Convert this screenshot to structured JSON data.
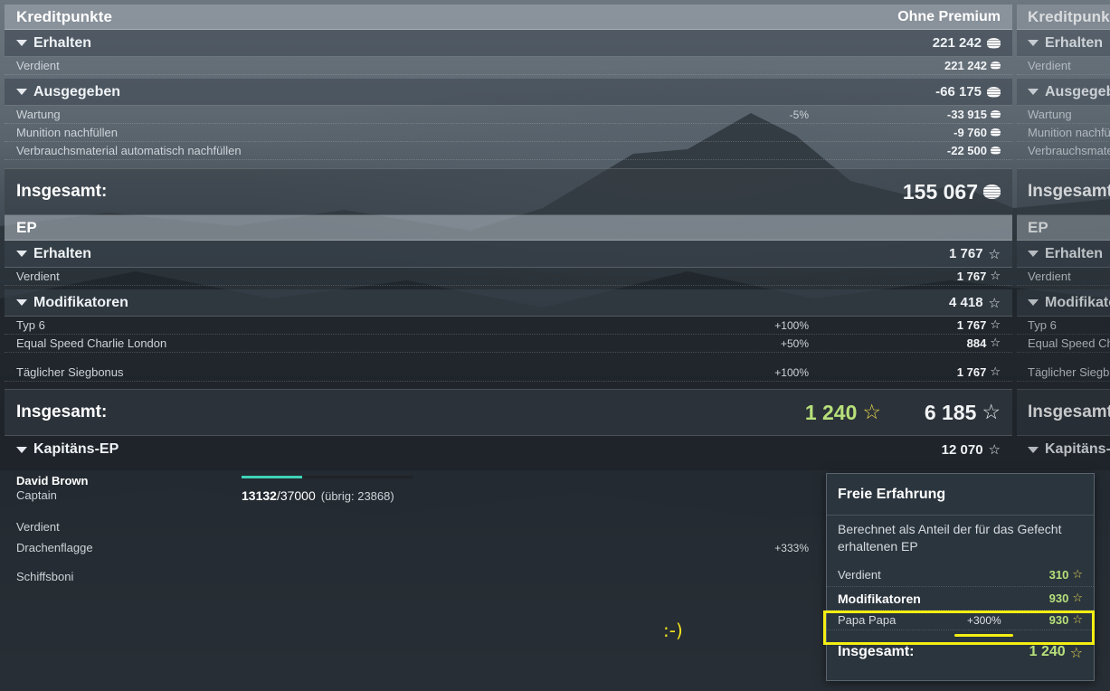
{
  "credits": {
    "title": "Kreditpunkte",
    "column_label": "Ohne Premium",
    "received": {
      "label": "Erhalten",
      "value": "221 242",
      "items": [
        {
          "label": "Verdient",
          "value": "221 242"
        }
      ]
    },
    "spent": {
      "label": "Ausgegeben",
      "value": "-66 175",
      "items": [
        {
          "label": "Wartung",
          "pct": "-5%",
          "value": "-33 915"
        },
        {
          "label": "Munition nachfüllen",
          "pct": "",
          "value": "-9 760"
        },
        {
          "label": "Verbrauchsmaterial automatisch nachfüllen",
          "pct": "",
          "value": "-22 500"
        }
      ]
    },
    "total": {
      "label": "Insgesamt:",
      "value": "155 067"
    }
  },
  "ep": {
    "title": "EP",
    "received": {
      "label": "Erhalten",
      "value": "1 767",
      "items": [
        {
          "label": "Verdient",
          "value": "1 767"
        }
      ]
    },
    "modifiers": {
      "label": "Modifikatoren",
      "value": "4 418",
      "items": [
        {
          "label": "Typ 6",
          "pct": "+100%",
          "value": "1 767"
        },
        {
          "label": "Equal Speed Charlie London",
          "pct": "+50%",
          "value": "884"
        },
        {
          "label": "Täglicher Siegbonus",
          "pct": "+100%",
          "value": "1 767"
        }
      ]
    },
    "total": {
      "label": "Insgesamt:",
      "free_value": "1 240",
      "value": "6 185"
    }
  },
  "captain_ep": {
    "label": "Kapitäns-EP",
    "value": "12 070",
    "captain_name": "David Brown",
    "captain_rank": "Captain",
    "xp_current": "13132",
    "xp_max": "/37000",
    "xp_remaining": "(übrig: 23868)",
    "progress": 0.355,
    "items": [
      {
        "label": "Verdient",
        "pct": ""
      },
      {
        "label": "Drachenflagge",
        "pct": "+333%"
      },
      {
        "label": "Schiffsboni",
        "pct": ""
      }
    ]
  },
  "annotation": ":-)",
  "tooltip": {
    "title": "Freie Erfahrung",
    "description": "Berechnet als Anteil der für das Gefecht erhaltenen EP",
    "earned_label": "Verdient",
    "earned_value": "310",
    "modifiers_label": "Modifikatoren",
    "modifiers_value": "930",
    "item_label": "Papa Papa",
    "item_pct": "+300%",
    "item_value": "930",
    "total_label": "Insgesamt:",
    "total_value": "1 240"
  },
  "second_panel": {
    "credits_title": "Kreditpunkte",
    "received_label": "Erhalten",
    "earned_label": "Verdient",
    "spent_label": "Ausgegeben",
    "spent_items": [
      "Wartung",
      "Munition nachfüllen",
      "Verbrauchsmaterial automatisch nachfüllen"
    ],
    "total_label": "Insgesamt:",
    "ep_title": "EP",
    "ep_received_label": "Erhalten",
    "ep_earned_label": "Verdient",
    "ep_modifiers_label": "Modifikatoren",
    "ep_items": [
      "Typ 6",
      "Equal Speed Charlie London",
      "Täglicher Siegbonus"
    ],
    "ep_total_label": "Insgesamt:",
    "captain_label": "Kapitäns-EP"
  },
  "colors": {
    "free_xp": "#b7e07a",
    "highlight": "#f4ee12",
    "progress": "#3fd3b8"
  },
  "icons": {
    "credits": "credit-coin-icon",
    "xp": "star-icon",
    "collapse": "triangle-down-icon"
  }
}
